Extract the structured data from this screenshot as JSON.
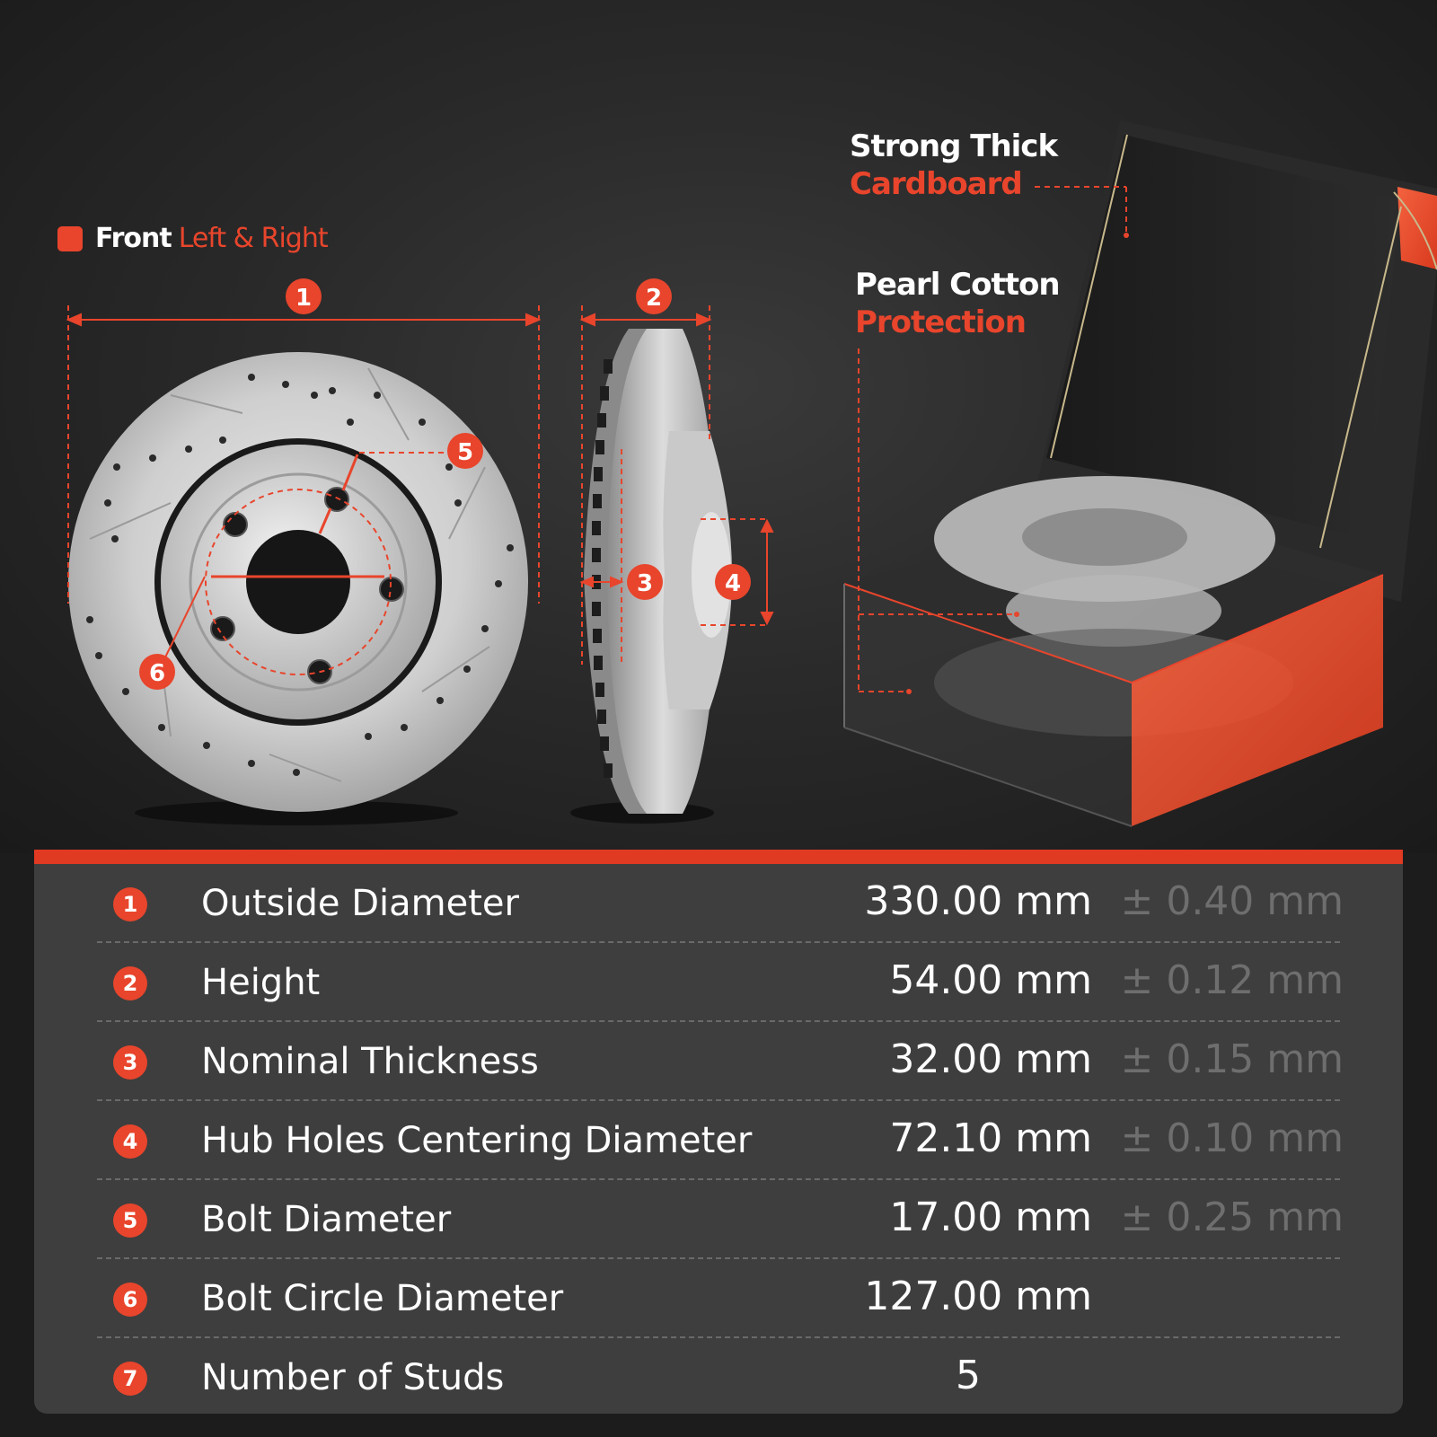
{
  "callouts": {
    "cardboard": {
      "line1": "Strong Thick",
      "line2": "Cardboard"
    },
    "pearl": {
      "line1": "Pearl Cotton",
      "line2": "Protection"
    }
  },
  "legend": {
    "bold": "Front",
    "rest": "Left & Right"
  },
  "markers": [
    "1",
    "2",
    "3",
    "4",
    "5",
    "6"
  ],
  "colors": {
    "accent": "#e8452c",
    "panel": "#3e3e3e",
    "tolerance": "#6e6e6e"
  },
  "specs": [
    {
      "num": "1",
      "name": "Outside Diameter",
      "value": "330.00 mm",
      "tolerance": "± 0.40 mm"
    },
    {
      "num": "2",
      "name": "Height",
      "value": "54.00 mm",
      "tolerance": "± 0.12 mm"
    },
    {
      "num": "3",
      "name": "Nominal Thickness",
      "value": "32.00 mm",
      "tolerance": "± 0.15 mm"
    },
    {
      "num": "4",
      "name": "Hub Holes Centering Diameter",
      "value": "72.10 mm",
      "tolerance": "± 0.10 mm"
    },
    {
      "num": "5",
      "name": "Bolt Diameter",
      "value": "17.00 mm",
      "tolerance": "± 0.25 mm"
    },
    {
      "num": "6",
      "name": "Bolt Circle Diameter",
      "value": "127.00 mm",
      "tolerance": ""
    },
    {
      "num": "7",
      "name": "Number of Studs",
      "value": "5",
      "tolerance": ""
    }
  ]
}
